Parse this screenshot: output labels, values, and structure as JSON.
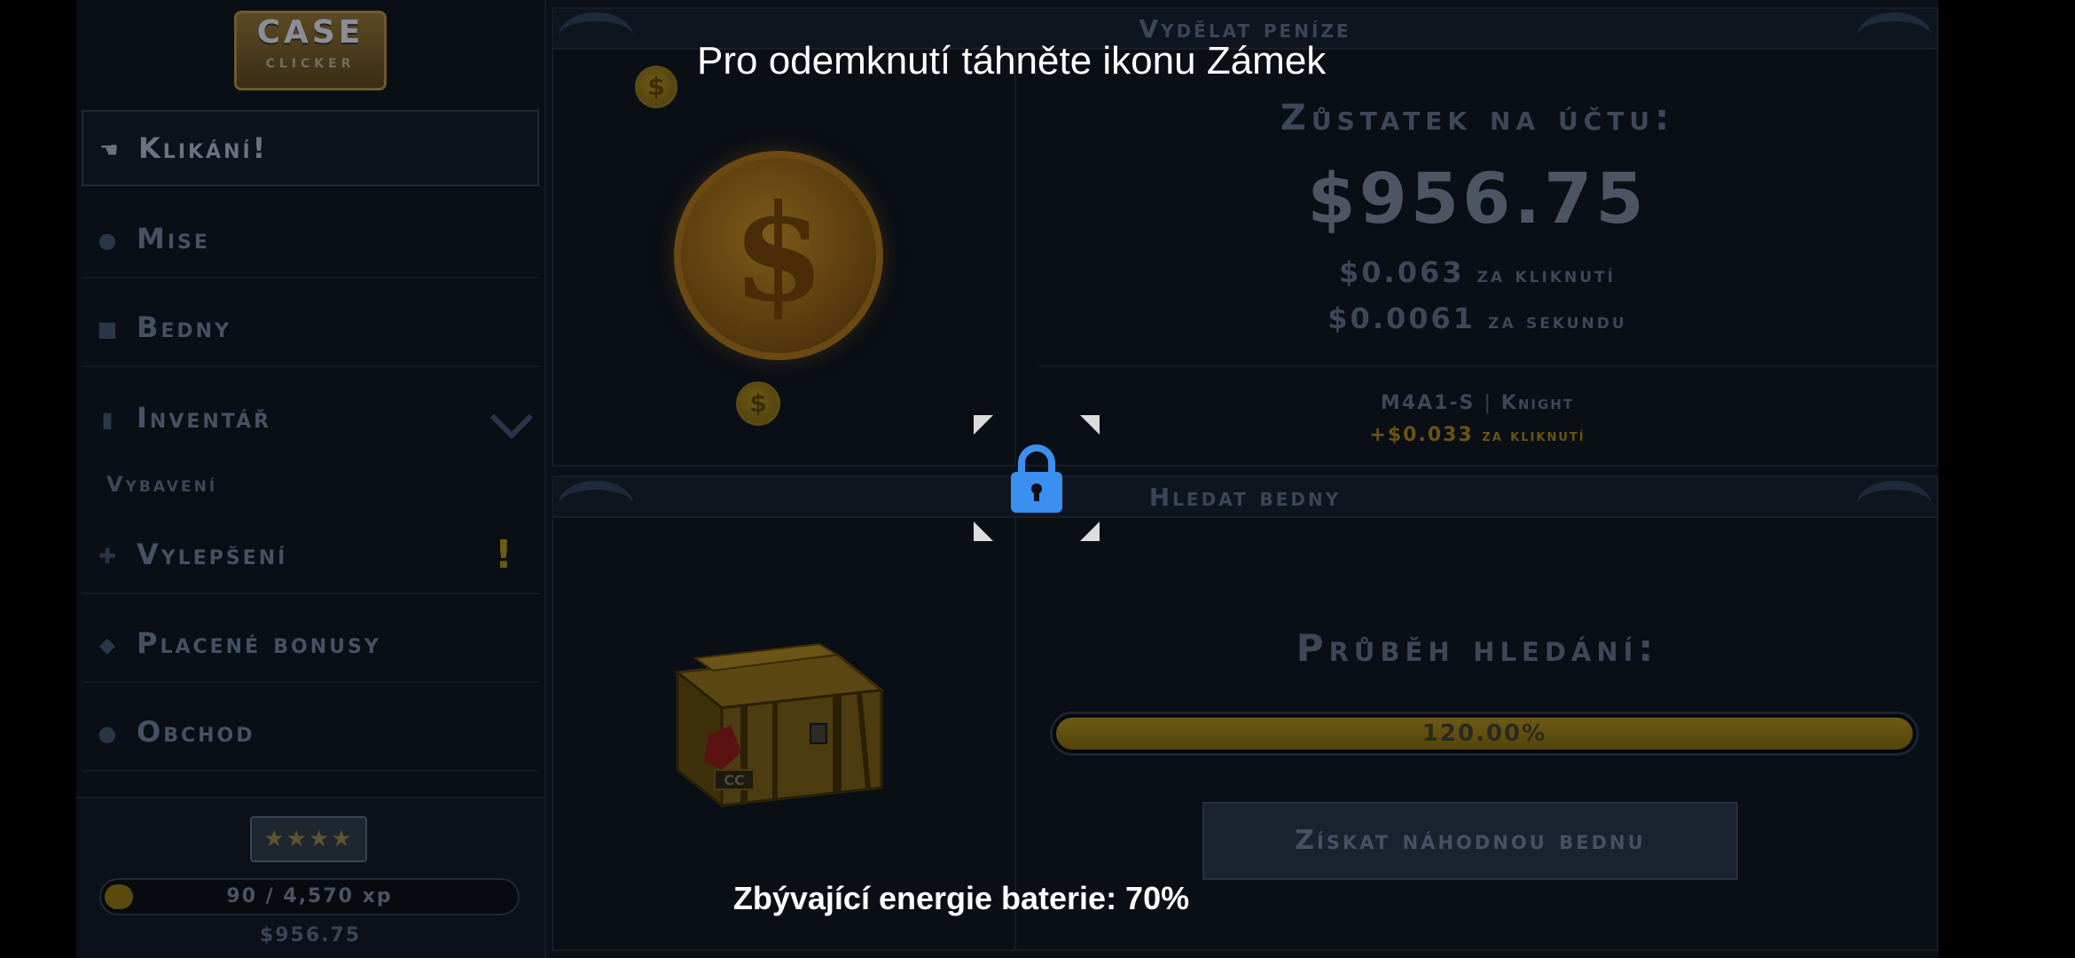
{
  "overlay": {
    "unlock_hint": "Pro odemknutí táhněte ikonu Zámek",
    "battery_text": "Zbývající energie baterie: 70%"
  },
  "logo": {
    "title": "CASE",
    "subtitle": "CLICKER"
  },
  "sidebar": {
    "items": [
      {
        "label": "Klikání!",
        "icon": "hand-pointer-icon"
      },
      {
        "label": "Mise",
        "icon": "circle-icon"
      },
      {
        "label": "Bedny",
        "icon": "box-icon"
      },
      {
        "label": "Inventář",
        "icon": "bag-icon"
      },
      {
        "label": "Vylepšení",
        "icon": "plus-icon"
      },
      {
        "label": "Placené bonusy",
        "icon": "diamond-icon"
      },
      {
        "label": "Obchod",
        "icon": "coin-icon"
      }
    ],
    "sub_item": "Vybavení",
    "alert": "!"
  },
  "profile": {
    "rank": "★★★★",
    "xp": "90 / 4,570 xp",
    "xp_progress": 0.02,
    "balance": "$956.75"
  },
  "earn_panel": {
    "title": "Vydělat peníze",
    "balance_label": "Zůstatek na účtu:",
    "balance_value": "$956.75",
    "per_click_value": "$0.063",
    "per_click_label": "za kliknutí",
    "per_second_value": "$0.0061",
    "per_second_label": "za sekundu",
    "weapon_name": "M4A1-S",
    "weapon_skin": "Knight",
    "weapon_bonus_value": "+$0.033",
    "weapon_bonus_label": "za kliknutí"
  },
  "crate_panel": {
    "title": "Hledat bedny",
    "progress_label": "Průběh hledání:",
    "progress_text": "120.00%",
    "progress_value": 1.0,
    "button_label": "Získat náhodnou bednu",
    "crate_tag": "CC"
  },
  "colors": {
    "accent_gold": "#6c5a14",
    "lock_blue": "#3b8ff0"
  }
}
